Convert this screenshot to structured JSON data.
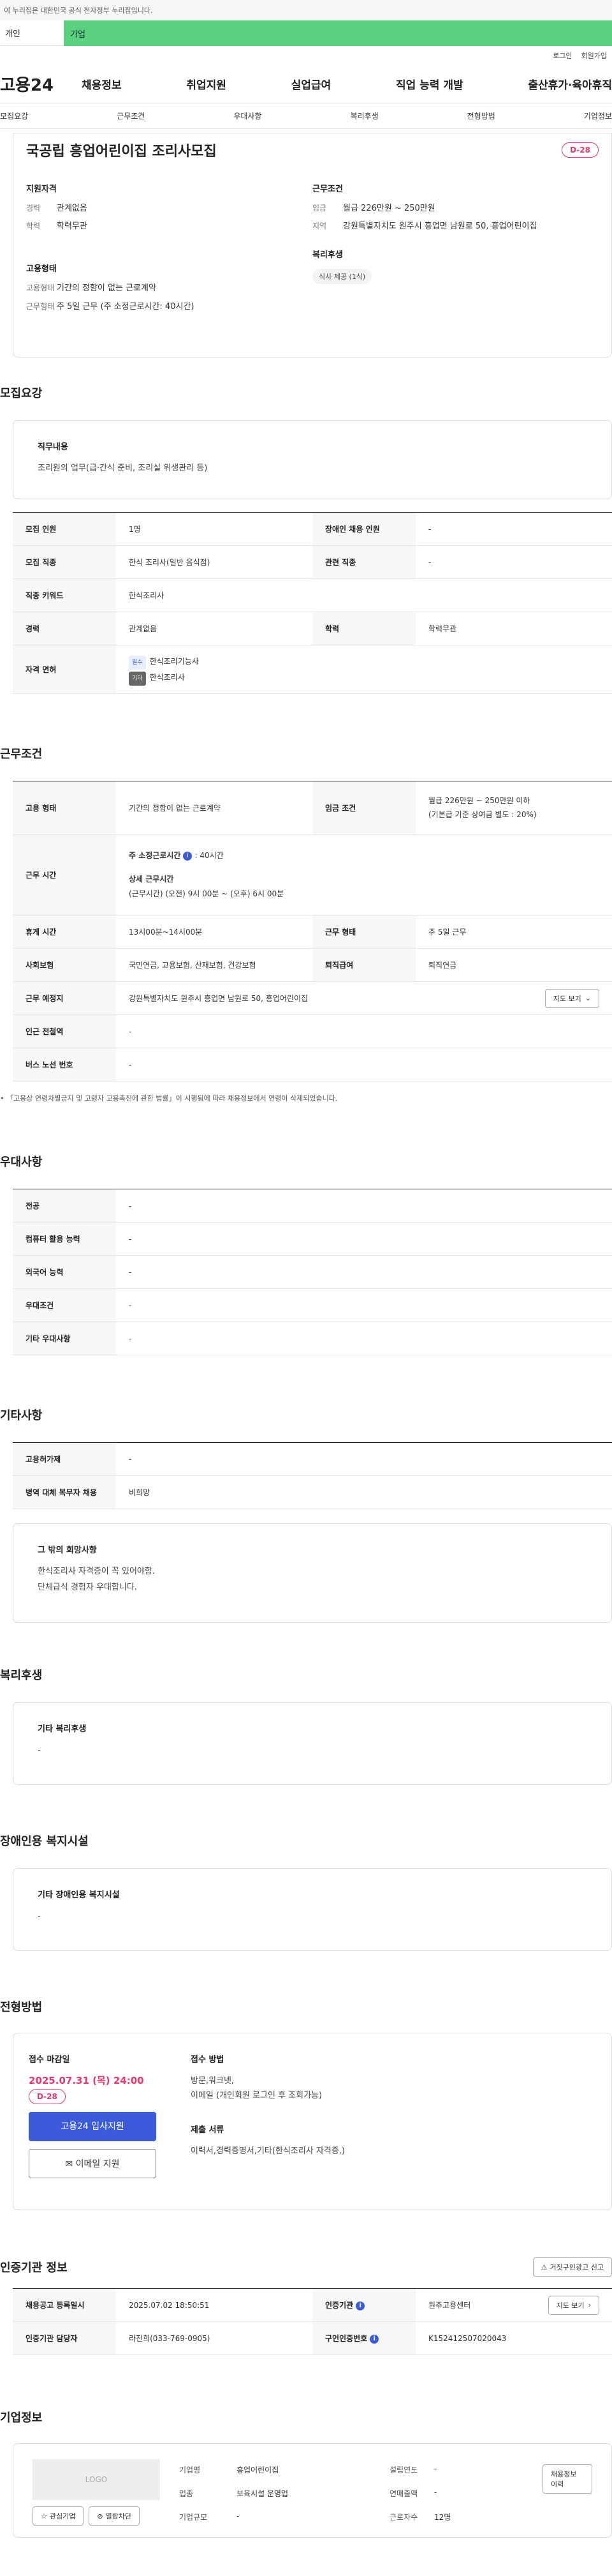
{
  "gov_notice": "이 누리집은 대한민국 공식 전자정부 누리집입니다.",
  "top_tabs": [
    "개인",
    "기업"
  ],
  "util_links": [
    "로그인",
    "회원가입"
  ],
  "header": {
    "logo": "고용24",
    "menu": [
      "채용정보",
      "취업지원",
      "실업급여",
      "직업 능력 개발",
      "출산휴가·육아휴직"
    ]
  },
  "anchors": [
    "모집요강",
    "근무조건",
    "우대사항",
    "복리후생",
    "전형방법",
    "기업정보"
  ],
  "job": {
    "title": "국공립 흥업어린이집 조리사모집",
    "dday": "D-28",
    "qual_title": "지원자격",
    "qual": [
      {
        "k": "경력",
        "v": "관계없음"
      },
      {
        "k": "학력",
        "v": "학력무관"
      }
    ],
    "cond_title": "근무조건",
    "cond": [
      {
        "k": "임금",
        "v": "월급 226만원 ~ 250만원"
      },
      {
        "k": "지역",
        "v": "강원특별자치도 원주시 흥업면 남원로 50, 흥업어린이집"
      }
    ],
    "emp_title": "고용형태",
    "emp": [
      {
        "k": "고용형태",
        "v": "기간의 정함이 없는 근로계약"
      },
      {
        "k": "근무형태",
        "v": "주 5일 근무 (주 소정근로시간: 40시간)"
      }
    ],
    "welfare_title": "복리후생",
    "welfare_chip": "식사 제공 (1식)"
  },
  "recruit": {
    "section_title": "모집요강",
    "duty_title": "직무내용",
    "duty_text": "조리원의 업무(급·간식 준비, 조리실 위생관리 등)",
    "rows": [
      {
        "h1": "모집 인원",
        "v1": "1명",
        "h2": "장애인 채용 인원",
        "v2": "-"
      },
      {
        "h1": "모집 직종",
        "v1": "한식 조리사(일반 음식점)",
        "h2": "관련 직종",
        "v2": "-"
      },
      {
        "h1": "직종 키워드",
        "v1": "한식조리사"
      },
      {
        "h1": "경력",
        "v1": "관계없음",
        "h2": "학력",
        "v2": "학력무관"
      }
    ],
    "license_header": "자격 면허",
    "licenses": [
      {
        "badge": "필수",
        "name": "한식조리기능사"
      },
      {
        "badge": "기타",
        "name": "한식조리사"
      }
    ]
  },
  "work": {
    "section_title": "근무조건",
    "emp_type_h": "고용 형태",
    "emp_type_v": "기간의 정함이 없는 근로계약",
    "wage_h": "임금 조건",
    "wage_v1": "월급 226만원 ~ 250만원 이하",
    "wage_v2": "(기본급 기준 상여금 별도 : 20%)",
    "hours_h": "근무 시간",
    "hours_label": "주 소정근로시간",
    "hours_value": ": 40시간",
    "detail_label": "상세 근무시간",
    "detail_value": "(근무시간) (오전) 9시 00분 ~ (오후) 6시 00분",
    "rest_h": "휴게 시간",
    "rest_v": "13시00분~14시00분",
    "worktype_h": "근무 형태",
    "worktype_v": "주 5일 근무",
    "insurance_h": "사회보험",
    "insurance_v": "국민연금, 고용보험, 산재보험, 건강보험",
    "retire_h": "퇴직급여",
    "retire_v": "퇴직연금",
    "place_h": "근무 예정지",
    "place_v": "강원특별자치도 원주시 흥업면 남원로 50, 흥업어린이집",
    "map_btn": "지도 보기",
    "subway_h": "인근 전철역",
    "subway_v": "-",
    "bus_h": "버스 노선 번호",
    "bus_v": "-",
    "note": "「고용상 연령차별금지 및 고령자 고용촉진에 관한 법률」이 시행됨에 따라 채용정보에서 연령이 삭제되었습니다."
  },
  "pref": {
    "section_title": "우대사항",
    "rows": [
      {
        "h": "전공",
        "v": "-"
      },
      {
        "h": "컴퓨터 활용 능력",
        "v": "-"
      },
      {
        "h": "외국어 능력",
        "v": "-"
      },
      {
        "h": "우대조건",
        "v": "-"
      },
      {
        "h": "기타 우대사항",
        "v": "-"
      }
    ]
  },
  "etc": {
    "section_title": "기타사항",
    "rows": [
      {
        "h": "고용허가제",
        "v": "-"
      },
      {
        "h": "병역 대체 복무자 채용",
        "v": "비희망"
      }
    ],
    "box_title": "그 밖의 희망사항",
    "box_lines": [
      "한식조리사 자격증이 꼭 있어야함.",
      "단체급식 경험자 우대합니다."
    ]
  },
  "welfare": {
    "section_title": "복리후생",
    "box_title": "기타 복리후생",
    "box_value": "-"
  },
  "disabled": {
    "section_title": "장애인용 복지시설",
    "box_title": "기타 장애인용 복지시설",
    "box_value": "-"
  },
  "selection": {
    "section_title": "전형방법",
    "deadline_title": "접수 마감일",
    "deadline": "2025.07.31 (목) 24:00",
    "dday": "D-28",
    "apply_btn": "고용24 입사지원",
    "email_btn": "이메일 지원",
    "method_title": "접수 방법",
    "method_lines": [
      "방문,워크넷,",
      "이메일 (개인회원 로그인 후 조회가능)"
    ],
    "docs_title": "제출 서류",
    "docs_value": "이력서,경력증명서,기타(한식조리사 자격증,)"
  },
  "cert": {
    "section_title": "인증기관 정보",
    "report_btn": "거짓구인광고 신고",
    "reg_h": "채용공고 등록일시",
    "reg_v": "2025.07.02 18:50:51",
    "org_h": "인증기관",
    "org_v": "원주고용센터",
    "map_btn": "지도 보기",
    "mgr_h": "인증기관 담당자",
    "mgr_v": "라진희(033-769-0905)",
    "num_h": "구인인증번호",
    "num_v": "K152412507020043"
  },
  "company": {
    "section_title": "기업정보",
    "logo": "LOGO",
    "fav_btn": "관심기업",
    "block_btn": "열람차단",
    "history_btn": "채용정보 이력",
    "name_k": "기업명",
    "name_v": "흥업어린이집",
    "year_k": "설립연도",
    "year_v": "-",
    "biz_k": "업종",
    "biz_v": "보육시설 운영업",
    "sales_k": "연매출액",
    "sales_v": "-",
    "size_k": "기업규모",
    "size_v": "-",
    "emp_k": "근로자수",
    "emp_v": "12명"
  }
}
